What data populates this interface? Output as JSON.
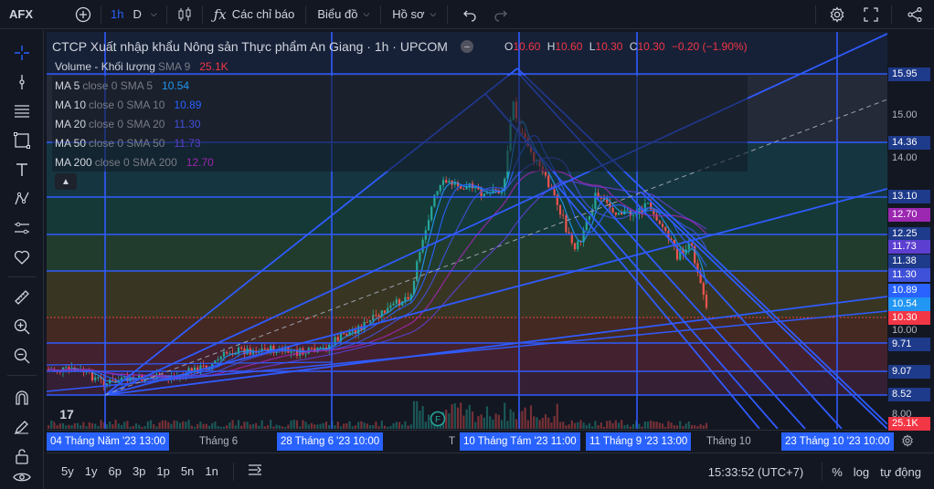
{
  "toolbar": {
    "symbol": "AFX",
    "interval": "1h",
    "interval_secondary": "D",
    "indicators_label": "Các chỉ báo",
    "chart_menu_label": "Biểu đồ",
    "profile_menu_label": "Hồ sơ"
  },
  "legend": {
    "title": "CTCP Xuất nhập khẩu Nông sản Thực phẩm An Giang · 1h · UPCOM",
    "ohlc": {
      "o_label": "O",
      "o": "10.60",
      "h_label": "H",
      "h": "10.60",
      "l_label": "L",
      "l": "10.30",
      "c_label": "C",
      "c": "10.30",
      "change": "−0.20 (−1.90%)"
    },
    "volume": {
      "name": "Volume - Khối lượng",
      "sub": "SMA 9",
      "value": "25.1K",
      "color": "#f23645"
    },
    "ma": [
      {
        "name": "MA 5",
        "sub": "close 0 SMA 5",
        "value": "10.54",
        "color": "#2196f3"
      },
      {
        "name": "MA 10",
        "sub": "close 0 SMA 10",
        "value": "10.89",
        "color": "#2962ff"
      },
      {
        "name": "MA 20",
        "sub": "close 0 SMA 20",
        "value": "11.30",
        "color": "#3f51d8"
      },
      {
        "name": "MA 50",
        "sub": "close 0 SMA 50",
        "value": "11.73",
        "color": "#5c3fd0"
      },
      {
        "name": "MA 200",
        "sub": "close 0 SMA 200",
        "value": "12.70",
        "color": "#9c27b0"
      }
    ]
  },
  "price_scale": {
    "levels": [
      {
        "text": "15.95",
        "kind": "level",
        "color": "#1e3a8a"
      },
      {
        "text": "15.00",
        "kind": "tick"
      },
      {
        "text": "14.36",
        "kind": "level",
        "color": "#1e3a8a"
      },
      {
        "text": "14.00",
        "kind": "tick"
      },
      {
        "text": "13.10",
        "kind": "level",
        "color": "#1e3a8a"
      },
      {
        "text": "12.70",
        "kind": "level",
        "color": "#9c27b0"
      },
      {
        "text": "12.25",
        "kind": "level",
        "color": "#1e3a8a"
      },
      {
        "text": "11.73",
        "kind": "level",
        "color": "#5c3fd0"
      },
      {
        "text": "11.38",
        "kind": "level",
        "color": "#1e3a8a"
      },
      {
        "text": "11.30",
        "kind": "level",
        "color": "#3f51d8"
      },
      {
        "text": "10.89",
        "kind": "level",
        "color": "#2962ff"
      },
      {
        "text": "10.54",
        "kind": "level",
        "color": "#2196f3"
      },
      {
        "text": "10.30",
        "kind": "level",
        "color": "#f23645"
      },
      {
        "text": "10.00",
        "kind": "tick"
      },
      {
        "text": "9.71",
        "kind": "level",
        "color": "#1e3a8a"
      },
      {
        "text": "9.07",
        "kind": "level",
        "color": "#1e3a8a"
      },
      {
        "text": "8.52",
        "kind": "level",
        "color": "#1e3a8a"
      },
      {
        "text": "8.00",
        "kind": "tick"
      },
      {
        "text": "25.1K",
        "kind": "level",
        "color": "#f23645"
      }
    ]
  },
  "time_scale": {
    "labels": [
      {
        "text": "04 Tháng Năm '23   13:00",
        "highlight": true
      },
      {
        "text": "Tháng 6",
        "highlight": false
      },
      {
        "text": "28 Tháng 6 '23   10:00",
        "highlight": true
      },
      {
        "text": "T",
        "highlight": false
      },
      {
        "text": "10 Tháng Tám '23   11:00",
        "highlight": true
      },
      {
        "text": "11 Tháng 9 '23   13:00",
        "highlight": true
      },
      {
        "text": "Tháng 10",
        "highlight": false
      },
      {
        "text": "23 Tháng 10 '23   10:00",
        "highlight": true
      }
    ]
  },
  "bottom": {
    "ranges": [
      "5y",
      "1y",
      "6p",
      "3p",
      "1p",
      "5n",
      "1n"
    ],
    "clock": "15:33:52 (UTC+7)",
    "percent": "%",
    "log": "log",
    "auto": "tự động"
  },
  "chart_markers": {
    "tv_logo": "17",
    "event_marker": "F"
  },
  "colors": {
    "up": "#26a69a",
    "down": "#ef5350",
    "accent": "#2962ff",
    "fib_line": "#2f5bff"
  }
}
